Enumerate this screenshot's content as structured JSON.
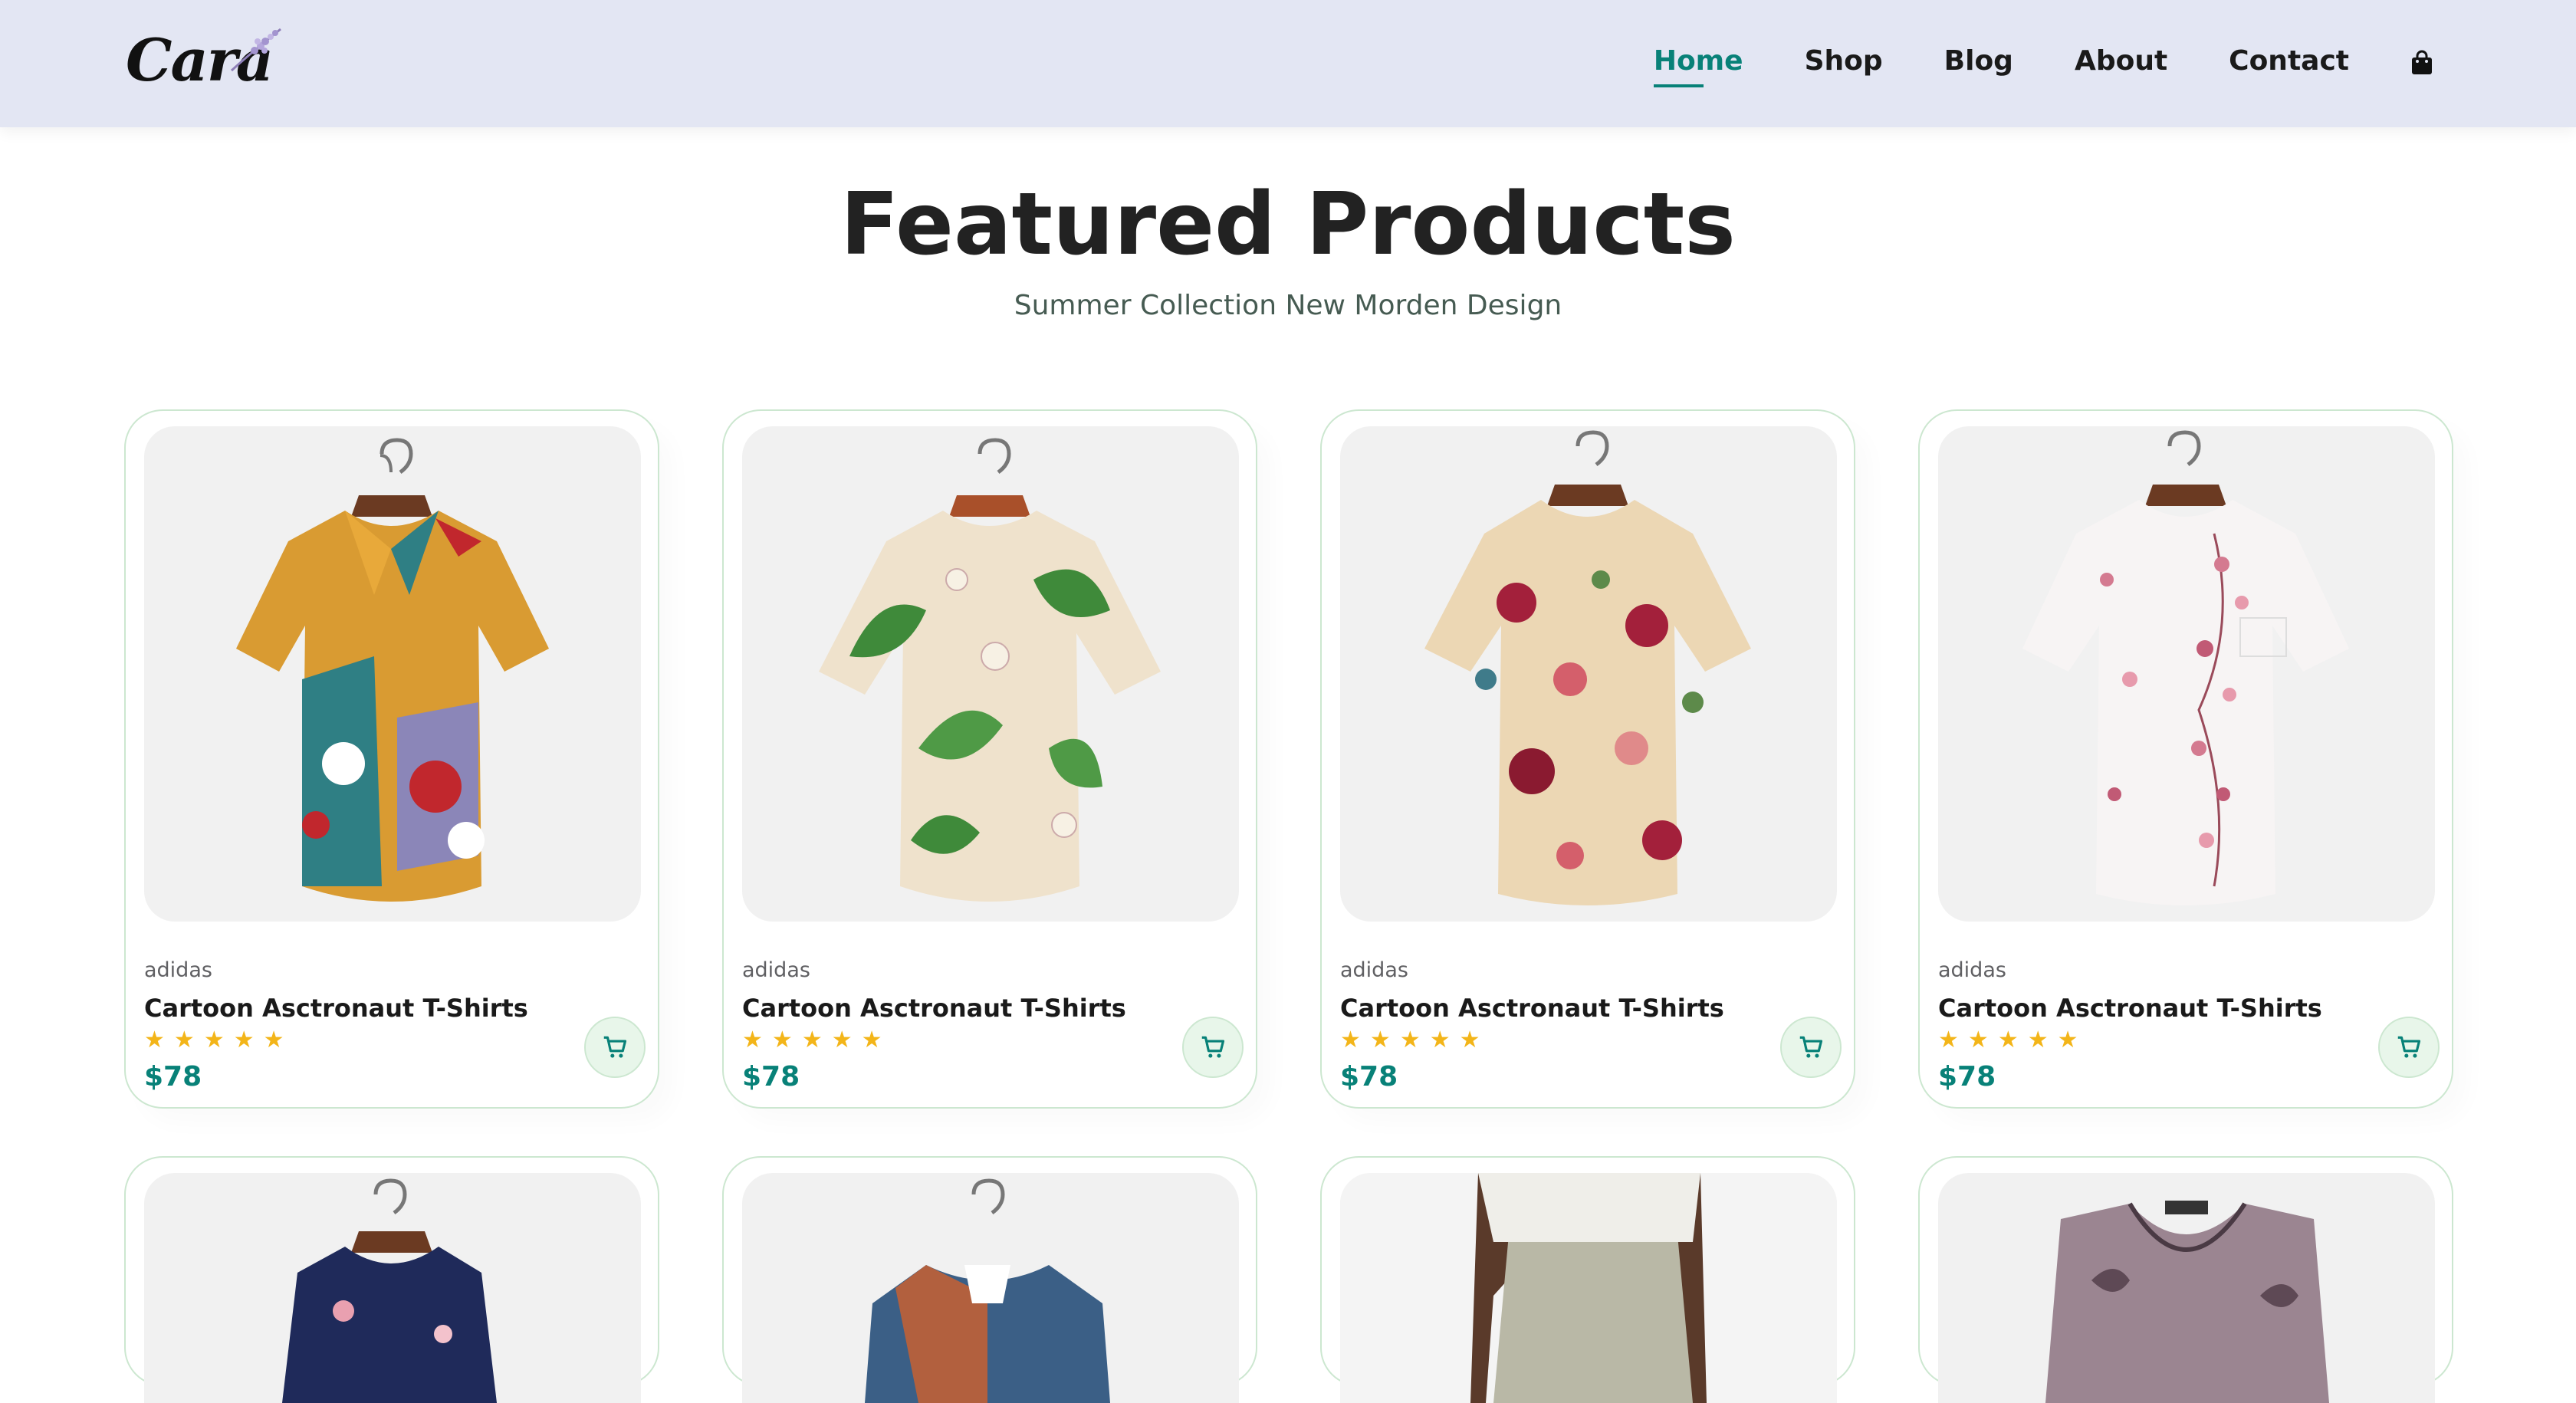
{
  "header": {
    "logo_alt": "Cara",
    "nav": [
      {
        "label": "Home",
        "active": true
      },
      {
        "label": "Shop",
        "active": false
      },
      {
        "label": "Blog",
        "active": false
      },
      {
        "label": "About",
        "active": false
      },
      {
        "label": "Contact",
        "active": false
      }
    ],
    "cart_icon": "shopping-bag-icon"
  },
  "section": {
    "title": "Featured Products",
    "subtitle": "Summer Collection New Morden Design"
  },
  "products": [
    {
      "brand": "adidas",
      "name": "Cartoon Asctronaut T-Shirts",
      "rating": 5,
      "price": "$78",
      "image": "shirt-cartoon-print"
    },
    {
      "brand": "adidas",
      "name": "Cartoon Asctronaut T-Shirts",
      "rating": 5,
      "price": "$78",
      "image": "shirt-green-leaf-print"
    },
    {
      "brand": "adidas",
      "name": "Cartoon Asctronaut T-Shirts",
      "rating": 5,
      "price": "$78",
      "image": "shirt-floral-beige"
    },
    {
      "brand": "adidas",
      "name": "Cartoon Asctronaut T-Shirts",
      "rating": 5,
      "price": "$78",
      "image": "shirt-white-pink-blossom"
    }
  ],
  "products_row2_images": [
    "shirt-navy-floral",
    "shirt-denim-rust",
    "pants-linen-grey",
    "top-paisley-mauve"
  ],
  "colors": {
    "accent": "#088178",
    "header_bg": "#e3e6f3",
    "star": "#f3b519",
    "border": "#cce7d0"
  }
}
